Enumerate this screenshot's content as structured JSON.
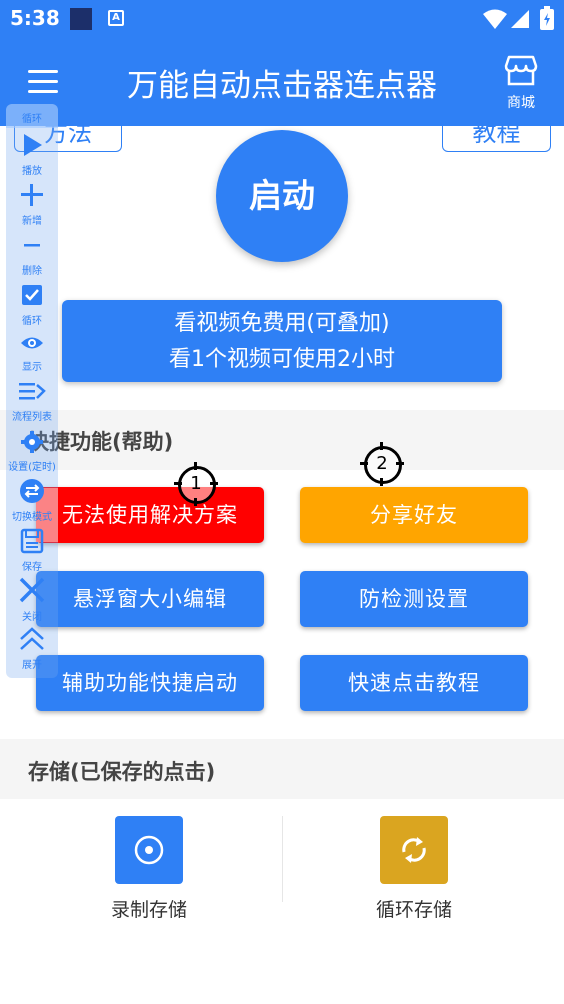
{
  "status_bar": {
    "time": "5:38",
    "a_badge": "A"
  },
  "app_bar": {
    "title": "万能自动点击器连点器",
    "shop_label": "商城",
    "menu_icon": "menu-icon",
    "shop_icon": "store-icon"
  },
  "top_buttons": {
    "method": "方法",
    "tutorial": "教程"
  },
  "start_button": "启动",
  "video_box": {
    "line1": "看视频免费用(可叠加)",
    "line2": "看1个视频可使用2小时"
  },
  "quick_section": {
    "title": "快捷功能(帮助)"
  },
  "quick_buttons": [
    {
      "label": "无法使用解决方案",
      "color": "#ff0000"
    },
    {
      "label": "分享好友",
      "color": "#ffa500"
    },
    {
      "label": "悬浮窗大小编辑",
      "color": "#2f80f5"
    },
    {
      "label": "防检测设置",
      "color": "#2f80f5"
    },
    {
      "label": "辅助功能快捷启动",
      "color": "#2f80f5"
    },
    {
      "label": "快速点击教程",
      "color": "#2f80f5"
    }
  ],
  "click_points": [
    {
      "number": "1"
    },
    {
      "number": "2"
    }
  ],
  "storage_section": {
    "title": "存储(已保存的点击)"
  },
  "storage_items": [
    {
      "label": "录制存储",
      "icon": "record-icon",
      "color": "#2f80f5"
    },
    {
      "label": "循环存储",
      "icon": "loop-icon",
      "color": "#daa520"
    }
  ],
  "floating_toolbar": {
    "top_label": "循环",
    "items": [
      {
        "label": "播放",
        "icon": "play-icon"
      },
      {
        "label": "新增",
        "icon": "plus-icon"
      },
      {
        "label": "删除",
        "icon": "minus-icon"
      },
      {
        "label": "循环",
        "icon": "checkbox-icon"
      },
      {
        "label": "显示",
        "icon": "eye-icon"
      },
      {
        "label": "流程列表",
        "icon": "list-icon"
      },
      {
        "label": "设置(定时)",
        "icon": "gear-icon"
      },
      {
        "label": "切换模式",
        "icon": "switch-icon"
      },
      {
        "label": "保存",
        "icon": "save-icon"
      },
      {
        "label": "关闭",
        "icon": "close-icon"
      },
      {
        "label": "展开",
        "icon": "expand-icon"
      }
    ]
  },
  "colors": {
    "primary": "#2f80f5",
    "red": "#ff0000",
    "orange": "#ffa500",
    "gold": "#daa520"
  }
}
